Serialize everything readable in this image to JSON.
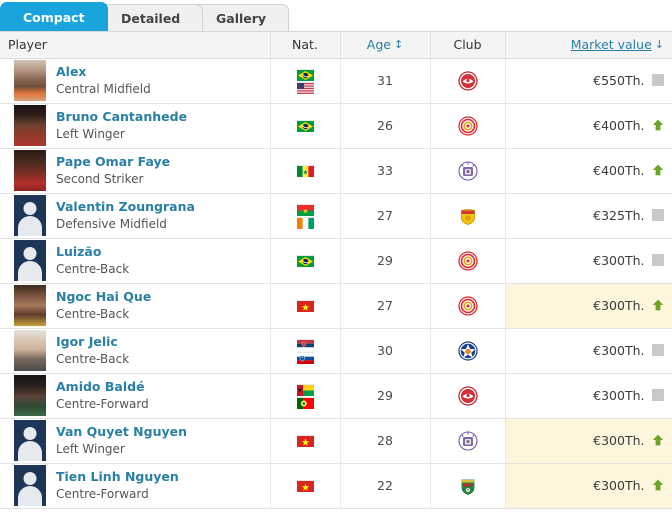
{
  "tabs": [
    {
      "label": "Compact",
      "active": true
    },
    {
      "label": "Detailed",
      "active": false
    },
    {
      "label": "Gallery",
      "active": false
    }
  ],
  "table": {
    "headers": {
      "player": "Player",
      "nat": "Nat.",
      "age": "Age",
      "club": "Club",
      "market_value": "Market value"
    },
    "sort": {
      "age_icon": "sort-updown-arrow",
      "market_value_icon": "sort-down-arrow",
      "active_column": "Market value",
      "direction": "desc"
    },
    "columns": [
      "Player",
      "Nat.",
      "Age",
      "Club",
      "Market value"
    ],
    "rows": [
      {
        "name": "Alex",
        "position": "Central Midfield",
        "photo": "portrait",
        "nationalities": [
          "Brazil",
          "United States"
        ],
        "age": "31",
        "club": "club-crest-red-olympiacos",
        "market_value": "€550Th.",
        "trend": "flat",
        "highlight": false
      },
      {
        "name": "Bruno Cantanhede",
        "position": "Left Winger",
        "photo": "portrait",
        "nationalities": [
          "Brazil"
        ],
        "age": "26",
        "club": "club-crest-red-target",
        "market_value": "€400Th.",
        "trend": "up",
        "highlight": false
      },
      {
        "name": "Pape Omar Faye",
        "position": "Second Striker",
        "photo": "portrait",
        "nationalities": [
          "Senegal"
        ],
        "age": "33",
        "club": "club-crest-purple",
        "market_value": "€400Th.",
        "trend": "up",
        "highlight": false
      },
      {
        "name": "Valentin Zoungrana",
        "position": "Defensive Midfield",
        "photo": "silhouette",
        "nationalities": [
          "Burkina Faso",
          "Ivory Coast"
        ],
        "age": "27",
        "club": "club-crest-yellow-shield",
        "market_value": "€325Th.",
        "trend": "flat",
        "highlight": false
      },
      {
        "name": "Luizão",
        "position": "Centre-Back",
        "photo": "silhouette",
        "nationalities": [
          "Brazil"
        ],
        "age": "29",
        "club": "club-crest-red-target",
        "market_value": "€300Th.",
        "trend": "flat",
        "highlight": false
      },
      {
        "name": "Ngoc Hai Que",
        "position": "Centre-Back",
        "photo": "portrait",
        "nationalities": [
          "Vietnam"
        ],
        "age": "27",
        "club": "club-crest-red-target",
        "market_value": "€300Th.",
        "trend": "up",
        "highlight": true
      },
      {
        "name": "Igor Jelic",
        "position": "Centre-Back",
        "photo": "portrait",
        "nationalities": [
          "Serbia",
          "Slovenia"
        ],
        "age": "30",
        "club": "club-crest-blue-star",
        "market_value": "€300Th.",
        "trend": "flat",
        "highlight": false
      },
      {
        "name": "Amido Baldé",
        "position": "Centre-Forward",
        "photo": "portrait",
        "nationalities": [
          "Guinea-Bissau",
          "Portugal"
        ],
        "age": "29",
        "club": "club-crest-red-olympiacos",
        "market_value": "€300Th.",
        "trend": "flat",
        "highlight": false
      },
      {
        "name": "Van Quyet Nguyen",
        "position": "Left Winger",
        "photo": "silhouette",
        "nationalities": [
          "Vietnam"
        ],
        "age": "28",
        "club": "club-crest-purple",
        "market_value": "€300Th.",
        "trend": "up",
        "highlight": true
      },
      {
        "name": "Tien Linh Nguyen",
        "position": "Centre-Forward",
        "photo": "silhouette",
        "nationalities": [
          "Vietnam"
        ],
        "age": "22",
        "club": "club-crest-green-shield",
        "market_value": "€300Th.",
        "trend": "up",
        "highlight": true
      }
    ]
  },
  "colors": {
    "active_tab": "#19A4DD",
    "link": "#2A7FA5",
    "trend_up": "#6CA424",
    "trend_flat": "#C9C9C9",
    "row_highlight": "#FDF5DC",
    "header_bg": "#F4F4F4"
  }
}
